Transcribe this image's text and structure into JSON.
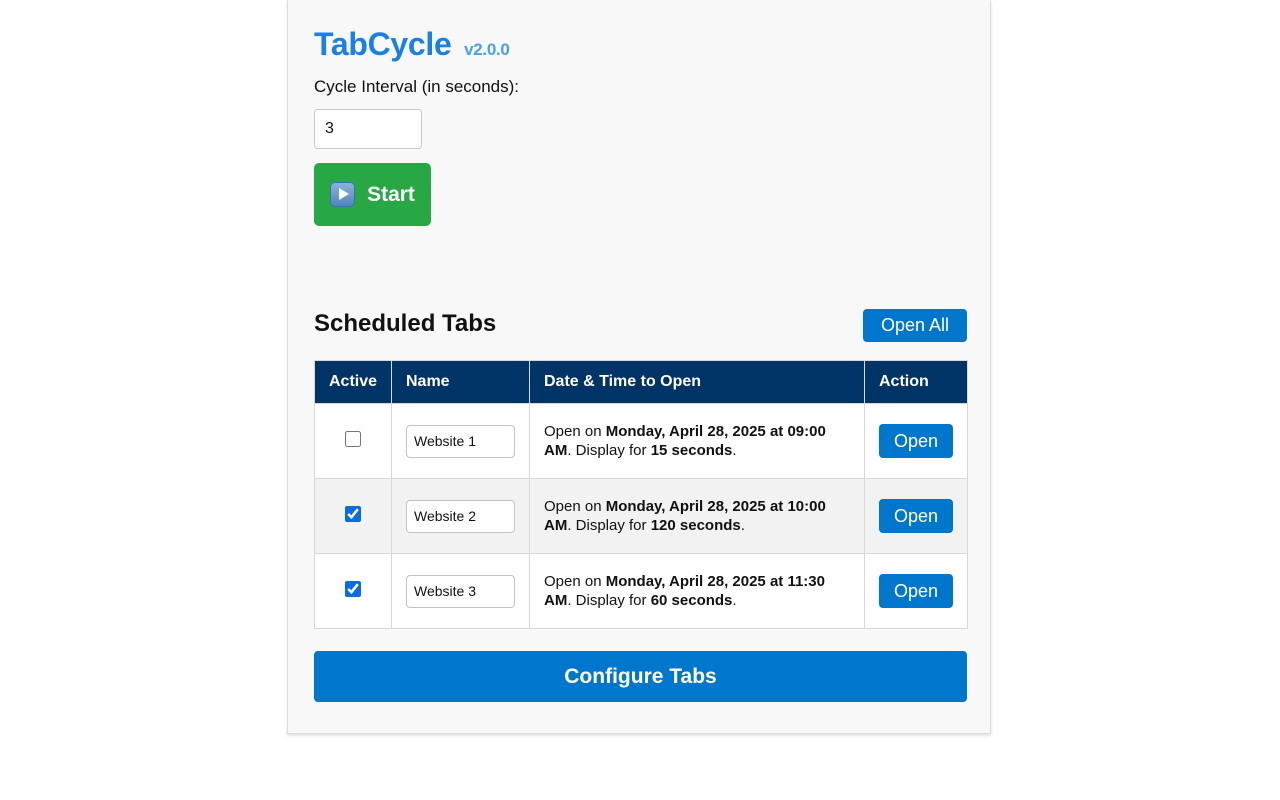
{
  "app": {
    "name": "TabCycle",
    "version": "v2.0.0"
  },
  "interval": {
    "label": "Cycle Interval (in seconds):",
    "value": "3"
  },
  "start_button": {
    "icon": "play-button-icon",
    "label": "Start"
  },
  "scheduled": {
    "title": "Scheduled Tabs",
    "open_all_label": "Open All",
    "columns": {
      "active": "Active",
      "name": "Name",
      "datetime": "Date & Time to Open",
      "action": "Action"
    },
    "rows": [
      {
        "active": false,
        "name": "Website 1",
        "open_prefix": "Open on ",
        "datetime": "Monday, April 28, 2025 at 09:00 AM",
        "display_prefix": ". Display for ",
        "duration": "15 seconds",
        "suffix": ".",
        "action_label": "Open"
      },
      {
        "active": true,
        "name": "Website 2",
        "open_prefix": "Open on ",
        "datetime": "Monday, April 28, 2025 at 10:00 AM",
        "display_prefix": ". Display for ",
        "duration": "120 seconds",
        "suffix": ".",
        "action_label": "Open"
      },
      {
        "active": true,
        "name": "Website 3",
        "open_prefix": "Open on ",
        "datetime": "Monday, April 28, 2025 at 11:30 AM",
        "display_prefix": ". Display for ",
        "duration": "60 seconds",
        "suffix": ".",
        "action_label": "Open"
      }
    ]
  },
  "configure_button": {
    "label": "Configure Tabs"
  },
  "colors": {
    "title_blue": "#1a7fe6",
    "start_green": "#28a745",
    "button_blue": "#0077cc",
    "header_navy": "#003366"
  }
}
